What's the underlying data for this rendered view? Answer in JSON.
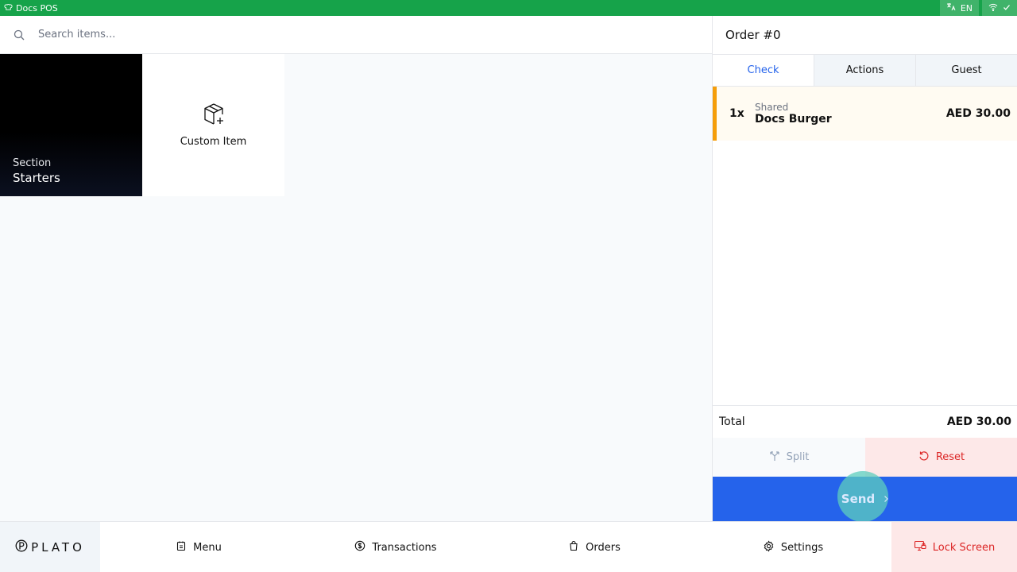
{
  "topbar": {
    "app_name": "Docs POS",
    "language": "EN"
  },
  "search": {
    "placeholder": "Search items..."
  },
  "tiles": {
    "section": {
      "subtitle": "Section",
      "name": "Starters"
    },
    "custom_item": {
      "label": "Custom Item"
    }
  },
  "order": {
    "title": "Order #0",
    "tabs": [
      {
        "label": "Check",
        "active": true
      },
      {
        "label": "Actions",
        "active": false
      },
      {
        "label": "Guest",
        "active": false
      }
    ],
    "lines": [
      {
        "qty": "1x",
        "note": "Shared",
        "name": "Docs Burger",
        "price": "AED 30.00"
      }
    ],
    "total_label": "Total",
    "total_amount": "AED 30.00",
    "split_label": "Split",
    "reset_label": "Reset",
    "send_label": "Send"
  },
  "bottombar": {
    "logo_text": "PLATO",
    "nav": [
      {
        "label": "Menu",
        "icon": "menu-icon"
      },
      {
        "label": "Transactions",
        "icon": "transactions-icon"
      },
      {
        "label": "Orders",
        "icon": "orders-icon"
      },
      {
        "label": "Settings",
        "icon": "gear-icon"
      }
    ],
    "lock_label": "Lock Screen"
  },
  "colors": {
    "topbar": "#16a34a",
    "accent": "#2563eb",
    "warning": "#f59e0b",
    "danger": "#dc2626"
  }
}
